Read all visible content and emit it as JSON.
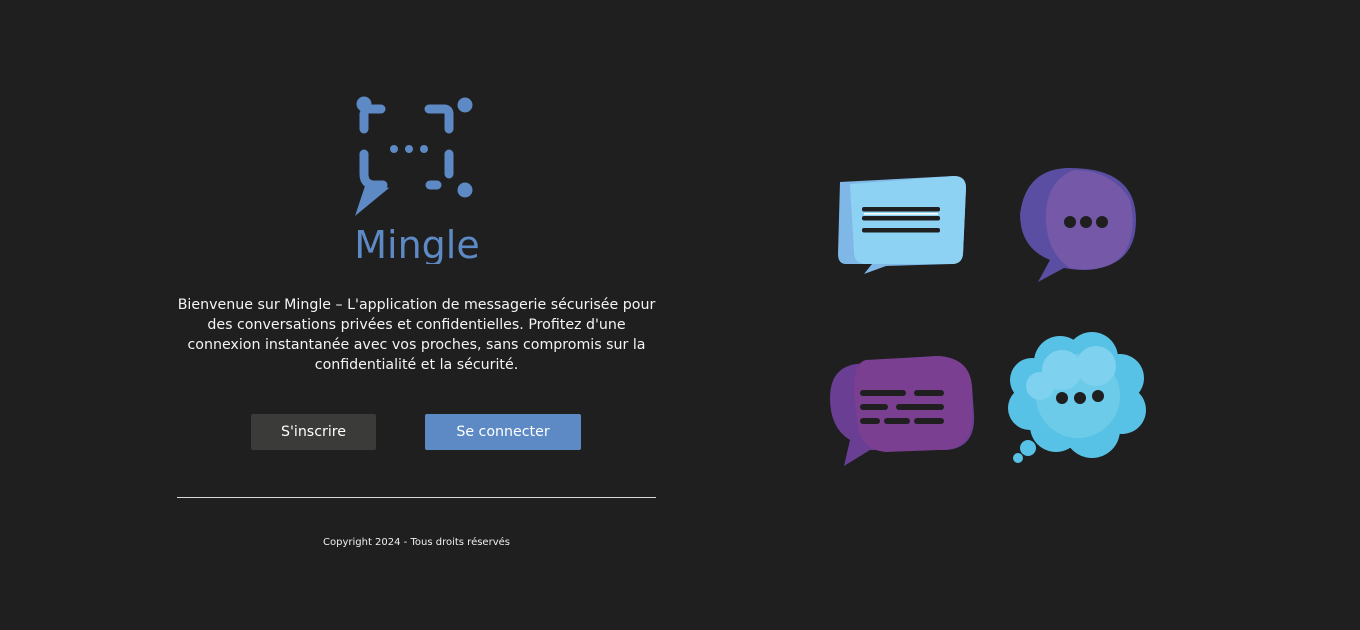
{
  "brand": {
    "name": "Mingle",
    "logo_color": "#5d8ac5"
  },
  "hero": {
    "welcome_text": "Bienvenue sur Mingle – L'application de messagerie sécurisée pour des conversations privées et confidentielles. Profitez d'une connexion instantanée avec vos proches, sans compromis sur la confidentialité et la sécurité."
  },
  "actions": {
    "register_label": "S'inscrire",
    "login_label": "Se connecter"
  },
  "footer": {
    "copyright": "Copyright 2024 - Tous droits réservés"
  },
  "illustration": {
    "icons": [
      "chat-bubble-lines-icon",
      "chat-bubble-dots-icon",
      "chat-bubble-text-icon",
      "thought-cloud-dots-icon"
    ]
  },
  "colors": {
    "background": "#1e1f1e",
    "accent": "#5d8ac5",
    "secondary_button": "#3b3b39"
  }
}
